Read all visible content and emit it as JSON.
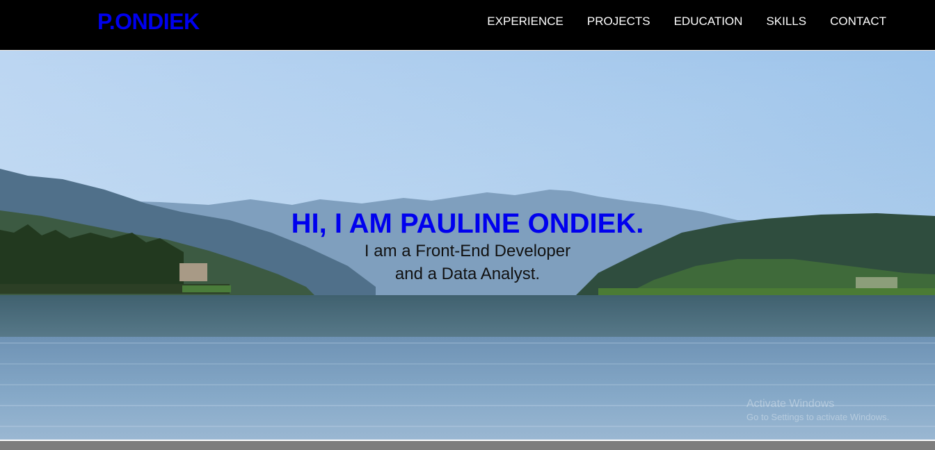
{
  "nav": {
    "logo": "P.ONDIEK",
    "links": [
      {
        "label": "EXPERIENCE"
      },
      {
        "label": "PROJECTS"
      },
      {
        "label": "EDUCATION"
      },
      {
        "label": "SKILLS"
      },
      {
        "label": "CONTACT"
      }
    ]
  },
  "hero": {
    "title": "HI, I AM PAULINE ONDIEK.",
    "subtitle_line1": "I am a Front-End Developer",
    "subtitle_line2": "and a Data Analyst."
  },
  "watermark": {
    "line1": "Activate Windows",
    "line2": "Go to Settings to activate Windows."
  },
  "colors": {
    "navbar_bg": "#000000",
    "accent_blue": "#0000ee",
    "nav_text": "#ffffff",
    "footer_strip": "#7d7d7d"
  }
}
